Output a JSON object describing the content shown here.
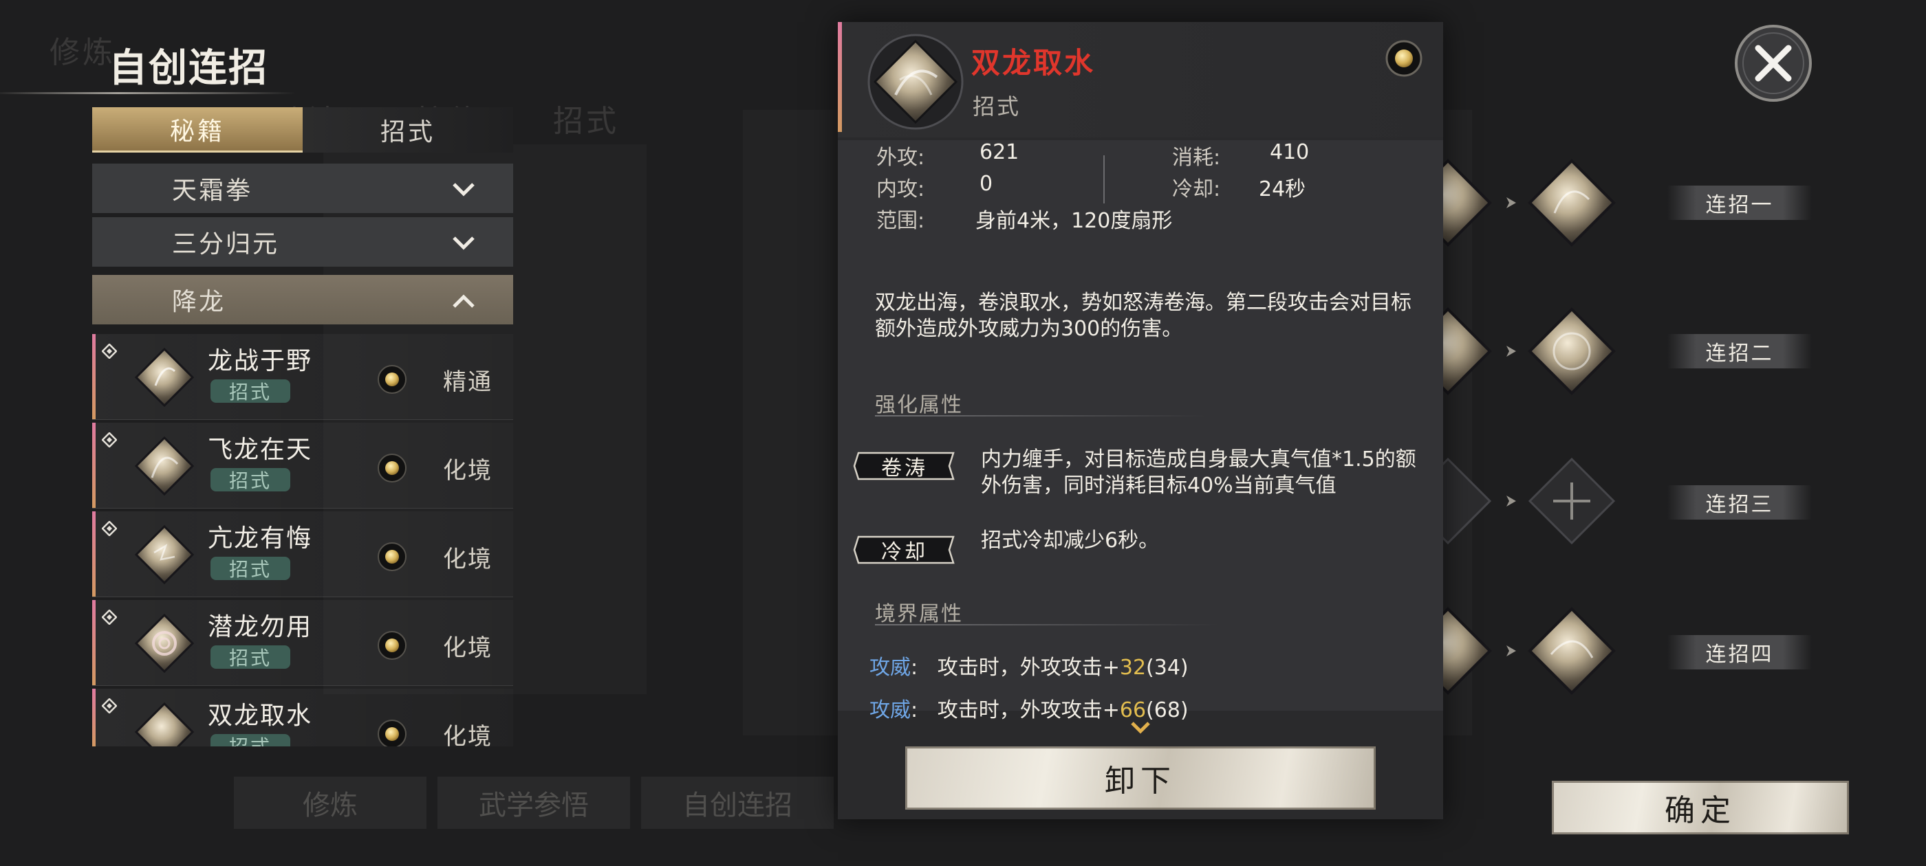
{
  "page": {
    "title": "自创连招"
  },
  "tabs": [
    {
      "label": "秘籍",
      "active": true
    },
    {
      "label": "招式",
      "active": false
    }
  ],
  "categories": [
    {
      "label": "天霜拳",
      "expanded": false
    },
    {
      "label": "三分归元",
      "expanded": false
    },
    {
      "label": "降龙",
      "expanded": true
    }
  ],
  "moves": [
    {
      "name": "龙战于野",
      "tag": "招式",
      "level": "精通"
    },
    {
      "name": "飞龙在天",
      "tag": "招式",
      "level": "化境"
    },
    {
      "name": "亢龙有悔",
      "tag": "招式",
      "level": "化境"
    },
    {
      "name": "潜龙勿用",
      "tag": "招式",
      "level": "化境"
    },
    {
      "name": "双龙取水",
      "tag": "招式",
      "level": "化境"
    }
  ],
  "detail": {
    "name": "双龙取水",
    "type": "招式",
    "stats": {
      "outer_attack_label": "外攻:",
      "outer_attack": "621",
      "inner_attack_label": "内攻:",
      "inner_attack": "0",
      "cost_label": "消耗:",
      "cost": "410",
      "cooldown_label": "冷却:",
      "cooldown": "24秒",
      "range_label": "范围:",
      "range": "身前4米，120度扇形"
    },
    "description": "双龙出海，卷浪取水，势如怒涛卷海。第二段攻击会对目标额外造成外攻威力为300的伤害。",
    "enhance_title": "强化属性",
    "enhancements": [
      {
        "tag": "卷涛",
        "text": "内力缠手，对目标造成自身最大真气值*1.5的额外伤害，同时消耗目标40%当前真气值"
      },
      {
        "tag": "冷却",
        "text": "招式冷却减少6秒。"
      }
    ],
    "realm_title": "境界属性",
    "realm_lines": [
      {
        "key": "攻威",
        "sep": ":",
        "text": "攻击时，外攻攻击+",
        "plus": "32",
        "total": "(34)"
      },
      {
        "key": "攻威",
        "sep": ":",
        "text": "攻击时，外攻攻击+",
        "plus": "66",
        "total": "(68)"
      }
    ],
    "unequip_label": "卸下"
  },
  "combo_slots": [
    {
      "label": "连招一"
    },
    {
      "label": "连招二"
    },
    {
      "label": "连招三"
    },
    {
      "label": "连招四"
    }
  ],
  "confirm_label": "确定",
  "background": {
    "ghost_title": "修炼",
    "ghost_tabs": [
      "功法",
      "护体",
      "招式"
    ],
    "bottom_tabs": [
      "修炼",
      "武学参悟",
      "自创连招"
    ]
  },
  "colors": {
    "skill_name": "#e0362c",
    "realm_key": "#6fa6e6",
    "realm_plus": "#e2bd4f",
    "tab_active": "#c9ad78",
    "tag_bg": "#3d5e55",
    "accent_bar": "#e07ba0"
  },
  "icons": {
    "close": "close-x-icon",
    "coin": "coin-icon",
    "chevron_down": "chevron-down-icon",
    "chevron_up": "chevron-up-icon",
    "add": "plus-icon"
  }
}
